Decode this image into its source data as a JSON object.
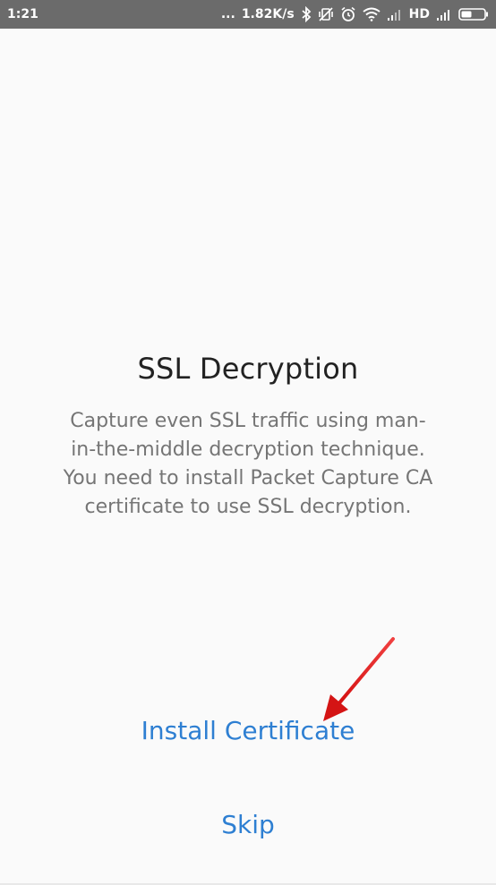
{
  "status_bar": {
    "time": "1:21",
    "dots": "...",
    "speed": "1.82K/s",
    "network_label": "HD",
    "icons": [
      "bluetooth-icon",
      "vibrate-icon",
      "alarm-icon",
      "wifi-icon",
      "signal-icon",
      "signal-icon",
      "battery-icon"
    ]
  },
  "main": {
    "title": "SSL Decryption",
    "description_lines": [
      "Capture even SSL traffic using man-",
      "in-the-middle decryption technique.",
      "You need to install Packet Capture CA",
      "certificate to use SSL decryption."
    ],
    "install_label": "Install Certificate",
    "skip_label": "Skip"
  },
  "colors": {
    "accent": "#2e7fd2",
    "status_bar": "#6b6b6b",
    "arrow": "#e02020"
  }
}
